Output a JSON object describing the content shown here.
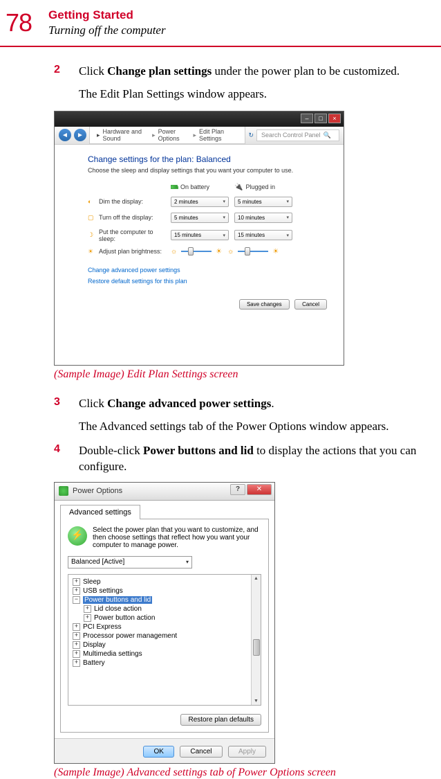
{
  "pageNumber": "78",
  "chapter": "Getting Started",
  "section": "Turning off the computer",
  "step2": {
    "num": "2",
    "pre": "Click ",
    "bold": "Change plan settings",
    "post": " under the power plan to be customized.",
    "followup": "The Edit Plan Settings window appears."
  },
  "screenshot1": {
    "nav": {
      "bc1": "Hardware and Sound",
      "bc2": "Power Options",
      "bc3": "Edit Plan Settings",
      "search": "Search Control Panel"
    },
    "title": "Change settings for the plan: Balanced",
    "subtitle": "Choose the sleep and display settings that you want your computer to use.",
    "colBattery": "On battery",
    "colPlugged": "Plugged in",
    "rows": {
      "dim": {
        "label": "Dim the display:",
        "battery": "2 minutes",
        "plugged": "5 minutes"
      },
      "off": {
        "label": "Turn off the display:",
        "battery": "5 minutes",
        "plugged": "10 minutes"
      },
      "sleep": {
        "label": "Put the computer to sleep:",
        "battery": "15 minutes",
        "plugged": "15 minutes"
      },
      "bright": {
        "label": "Adjust plan brightness:"
      }
    },
    "linkAdvanced": "Change advanced power settings",
    "linkRestore": "Restore default settings for this plan",
    "save": "Save changes",
    "cancel": "Cancel"
  },
  "caption1": "(Sample Image) Edit Plan Settings screen",
  "step3": {
    "num": "3",
    "pre": "Click ",
    "bold": "Change advanced power settings",
    "post": ".",
    "followup": "The Advanced settings tab of the Power Options window appears."
  },
  "step4": {
    "num": "4",
    "pre": "Double-click ",
    "bold": "Power buttons and lid",
    "post": " to display the actions that you can configure."
  },
  "screenshot2": {
    "title": "Power Options",
    "tab": "Advanced settings",
    "desc": "Select the power plan that you want to customize, and then choose settings that reflect how you want your computer to manage power.",
    "plan": "Balanced [Active]",
    "tree": {
      "sleep": "Sleep",
      "usb": "USB settings",
      "pbl": "Power buttons and lid",
      "lid": "Lid close action",
      "pba": "Power button action",
      "pci": "PCI Express",
      "ppm": "Processor power management",
      "display": "Display",
      "mm": "Multimedia settings",
      "battery": "Battery"
    },
    "restore": "Restore plan defaults",
    "ok": "OK",
    "cancel": "Cancel",
    "apply": "Apply"
  },
  "caption2": "(Sample Image) Advanced settings tab of Power Options screen"
}
